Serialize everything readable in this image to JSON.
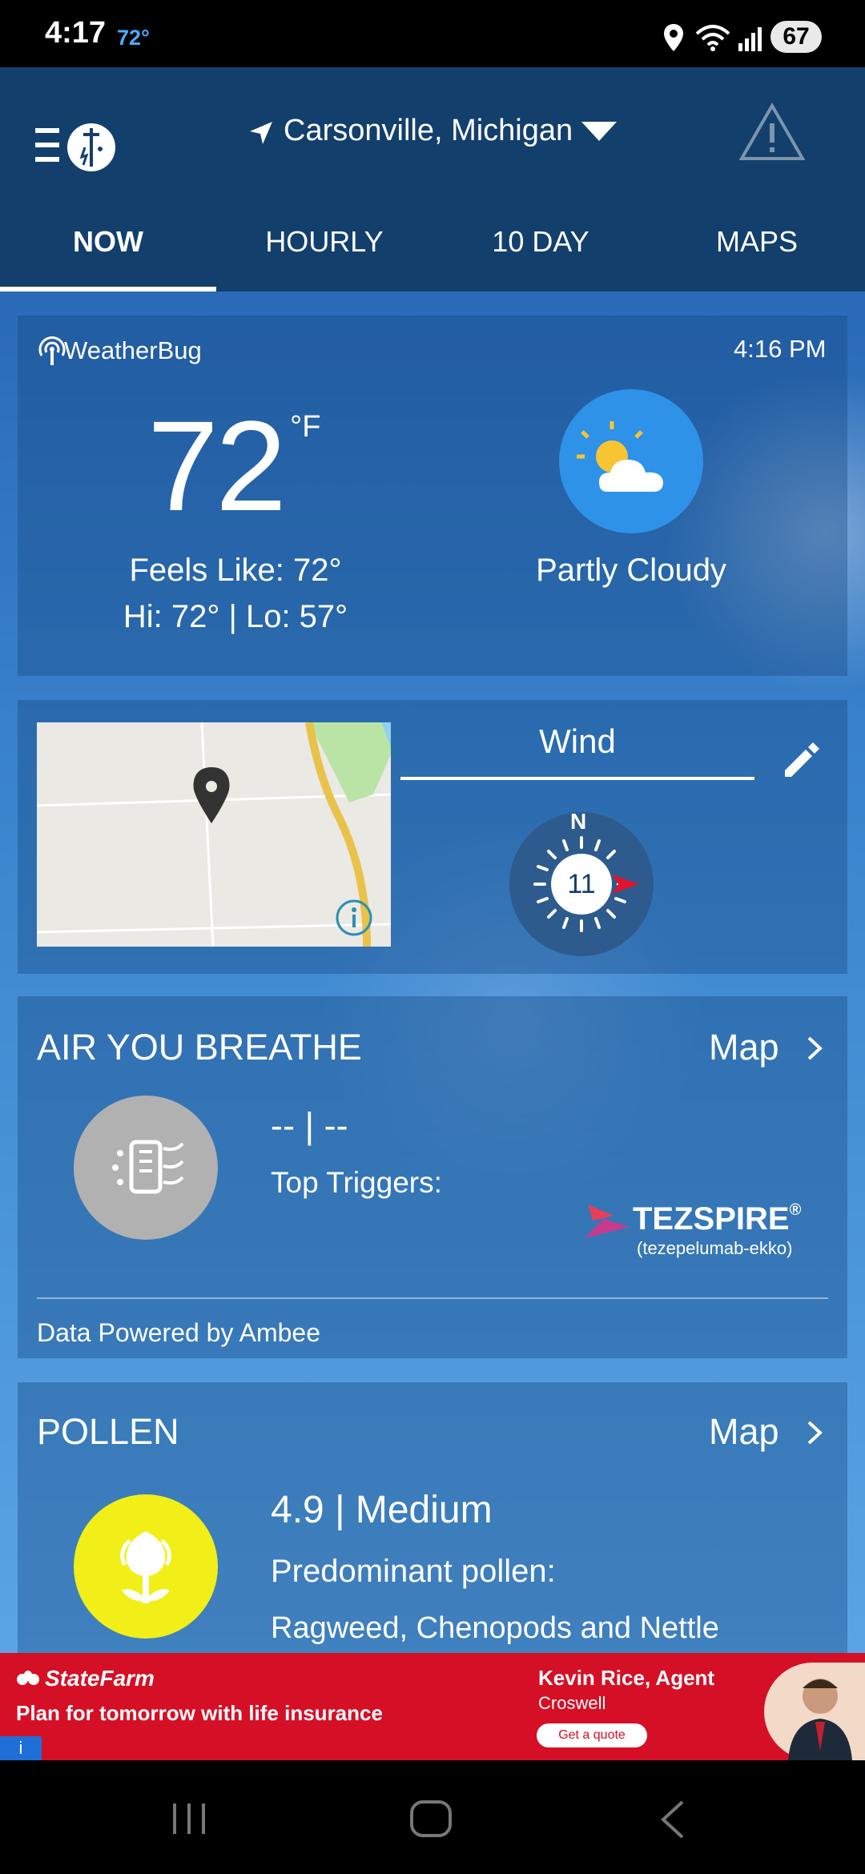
{
  "status_bar": {
    "time": "4:17",
    "temp": "72°",
    "battery": "67"
  },
  "header": {
    "location": "Carsonville, Michigan",
    "tabs": [
      "NOW",
      "HOURLY",
      "10 DAY",
      "MAPS"
    ],
    "active_tab": "NOW"
  },
  "current": {
    "brand": "WeatherBug",
    "updated": "4:16 PM",
    "temperature": "72",
    "unit": "°F",
    "feels_like": "Feels Like: 72°",
    "hi_lo": "Hi: 72° | Lo: 57°",
    "condition": "Partly Cloudy"
  },
  "wind": {
    "title": "Wind",
    "direction_label": "N",
    "speed": "11"
  },
  "air": {
    "title": "AIR YOU BREATHE",
    "map_link": "Map",
    "value": "-- | --",
    "top_triggers": "Top Triggers:",
    "sponsor": "TEZSPIRE",
    "sponsor_reg": "®",
    "sponsor_sub": "(tezepelumab-ekko)",
    "powered_by": "Data Powered by Ambee"
  },
  "pollen": {
    "title": "POLLEN",
    "map_link": "Map",
    "value": "4.9 | Medium",
    "label": "Predominant pollen:",
    "types": "Ragweed, Chenopods and Nettle"
  },
  "ad": {
    "brand": "StateFarm",
    "message": "Plan for tomorrow with life insurance",
    "agent": "Kevin Rice, Agent",
    "city": "Croswell",
    "cta": "Get a quote",
    "info": "i"
  },
  "colors": {
    "header_bg": "#123f6b",
    "ad_red": "#d50f25",
    "pollen_yellow": "#f2ef18",
    "sun_blue": "#2e93e8"
  }
}
